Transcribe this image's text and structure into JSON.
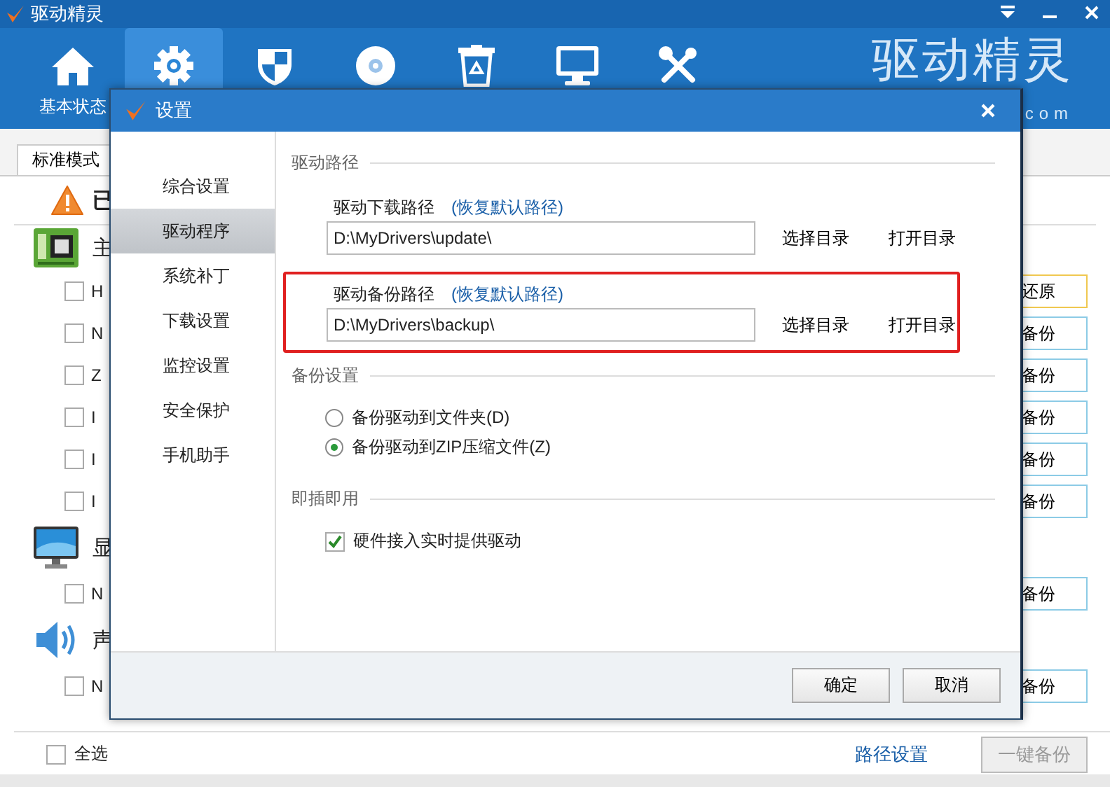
{
  "window": {
    "title": "驱动精灵"
  },
  "toolbar": [
    {
      "label": "基本状态",
      "selected": false
    },
    {
      "selected": true
    },
    {
      "selected": false
    },
    {
      "selected": false
    },
    {
      "selected": false
    },
    {
      "selected": false
    },
    {
      "selected": false
    }
  ],
  "logo": {
    "text": "驱动精灵",
    "suffix": "com"
  },
  "mode_tabs": [
    {
      "label": "标准模式",
      "selected": true
    }
  ],
  "status": {
    "text": "已"
  },
  "device_groups": [
    {
      "kind": "mainboard",
      "title": "主",
      "rows": [
        {
          "name": "H",
          "checked": false,
          "action": {
            "kind": "restore",
            "label": "还原"
          }
        },
        {
          "name": "N",
          "checked": false,
          "action": {
            "kind": "backup",
            "label": "备份"
          }
        },
        {
          "name": "Z",
          "checked": false,
          "action": {
            "kind": "backup",
            "label": "备份"
          }
        },
        {
          "name": "I",
          "checked": false,
          "action": {
            "kind": "backup",
            "label": "备份"
          }
        },
        {
          "name": "I",
          "checked": false,
          "action": {
            "kind": "backup",
            "label": "备份"
          }
        },
        {
          "name": "I",
          "checked": false,
          "action": {
            "kind": "backup",
            "label": "备份"
          }
        }
      ]
    },
    {
      "kind": "display",
      "title": "显",
      "rows": [
        {
          "name": "N",
          "checked": false,
          "action": {
            "kind": "backup",
            "label": "备份"
          }
        }
      ]
    },
    {
      "kind": "sound",
      "title": "声",
      "rows": [
        {
          "name": "N",
          "checked": false,
          "action": {
            "kind": "backup",
            "label": "备份"
          }
        }
      ]
    }
  ],
  "footer": {
    "select_all": {
      "label": "全选",
      "checked": false
    },
    "path_link": "路径设置",
    "backup_all": {
      "label": "一键备份",
      "disabled": true
    }
  },
  "dialog": {
    "title": "设置",
    "nav": [
      {
        "label": "综合设置",
        "selected": false
      },
      {
        "label": "驱动程序",
        "selected": true
      },
      {
        "label": "系统补丁",
        "selected": false
      },
      {
        "label": "下载设置",
        "selected": false
      },
      {
        "label": "监控设置",
        "selected": false
      },
      {
        "label": "安全保护",
        "selected": false
      },
      {
        "label": "手机助手",
        "selected": false
      }
    ],
    "sections": [
      {
        "kind": "paths",
        "title": "驱动路径",
        "paths": [
          {
            "label": "驱动下载路径",
            "reset_link": "(恢复默认路径)",
            "value": "D:\\MyDrivers\\update\\",
            "choose": "选择目录",
            "open": "打开目录",
            "highlighted": false
          },
          {
            "label": "驱动备份路径",
            "reset_link": "(恢复默认路径)",
            "value": "D:\\MyDrivers\\backup\\",
            "choose": "选择目录",
            "open": "打开目录",
            "highlighted": true
          }
        ]
      },
      {
        "kind": "radios",
        "title": "备份设置",
        "options": [
          {
            "label": "备份驱动到文件夹(D)",
            "selected": false
          },
          {
            "label": "备份驱动到ZIP压缩文件(Z)",
            "selected": true
          }
        ]
      },
      {
        "kind": "checks",
        "title": "即插即用",
        "options": [
          {
            "label": "硬件接入实时提供驱动",
            "checked": true
          }
        ]
      }
    ],
    "buttons": [
      {
        "label": "确定"
      },
      {
        "label": "取消"
      }
    ]
  }
}
